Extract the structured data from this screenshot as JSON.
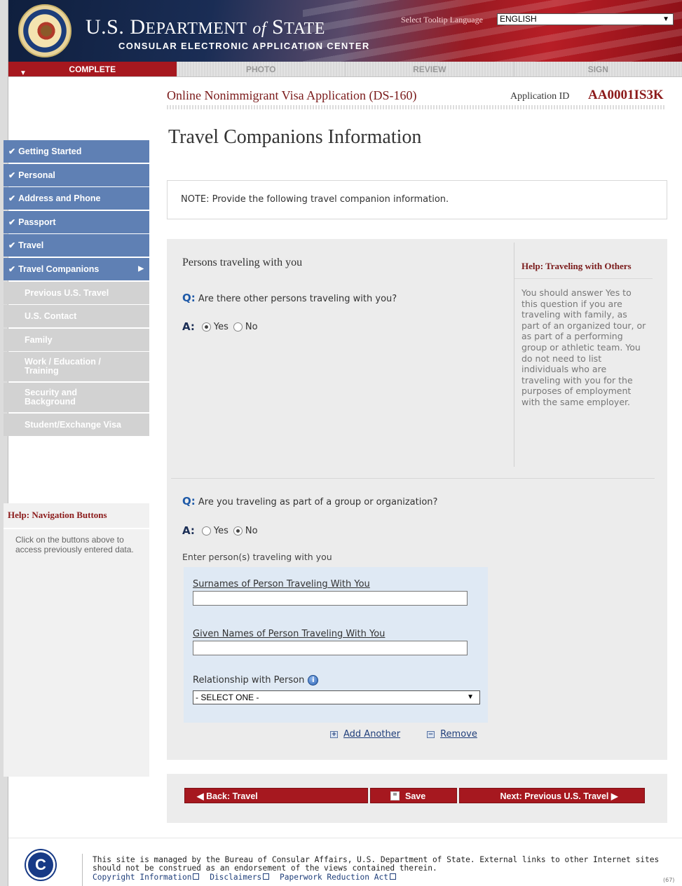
{
  "header": {
    "dept_main": "U.S. D",
    "dept_1": "EPARTMENT",
    "dept_of": "of",
    "dept_2": "S",
    "dept_3": "TATE",
    "subtitle": "CONSULAR ELECTRONIC APPLICATION CENTER",
    "tooltip_language_label": "Select Tooltip Language",
    "tooltip_language_value": "ENGLISH"
  },
  "progress_tabs": [
    {
      "label": "COMPLETE"
    },
    {
      "label": "PHOTO"
    },
    {
      "label": "REVIEW"
    },
    {
      "label": "SIGN"
    }
  ],
  "application": {
    "title": "Online Nonimmigrant Visa Application (DS-160)",
    "id_label": "Application ID",
    "id_value": "AA0001IS3K"
  },
  "page_heading": "Travel Companions Information",
  "sidebar": {
    "items": [
      {
        "label": "Getting Started",
        "state": "done"
      },
      {
        "label": "Personal",
        "state": "done"
      },
      {
        "label": "Address and Phone",
        "state": "done"
      },
      {
        "label": "Passport",
        "state": "done"
      },
      {
        "label": "Travel",
        "state": "done"
      },
      {
        "label": "Travel Companions",
        "state": "current"
      },
      {
        "label": "Previous U.S. Travel",
        "state": "todo"
      },
      {
        "label": "U.S. Contact",
        "state": "todo"
      },
      {
        "label": "Family",
        "state": "todo"
      },
      {
        "label": "Work / Education / Training",
        "state": "todo"
      },
      {
        "label": "Security and Background",
        "state": "todo"
      },
      {
        "label": "Student/Exchange Visa",
        "state": "todo"
      }
    ],
    "help_title_prefix": "Help:",
    "help_title": "Navigation Buttons",
    "help_text": "Click on the buttons above to access previously entered data."
  },
  "note": "NOTE: Provide the following travel companion information.",
  "section": {
    "title": "Persons traveling with you",
    "q_prefix": "Q:",
    "a_prefix": "A:",
    "q1": "Are there other persons traveling with you?",
    "q1_yes": "Yes",
    "q1_no": "No",
    "q2": "Are you traveling as part of a group or organization?",
    "q2_yes": "Yes",
    "q2_no": "No",
    "enter_label": "Enter person(s) traveling with you"
  },
  "help_panel": {
    "prefix": "Help:",
    "title": "Traveling with Others",
    "text": "You should answer Yes to this question if you are traveling with family, as part of an organized tour, or as part of a performing group or athletic team. You do not need to list individuals who are traveling with you for the purposes of employment with the same employer."
  },
  "companion_form": {
    "surname_label": "Surnames of Person Traveling With You",
    "surname_value": "",
    "given_label": "Given Names of Person Traveling With You",
    "given_value": "",
    "relationship_label": "Relationship with Person",
    "relationship_value": "- SELECT ONE -",
    "add_label": "Add Another",
    "remove_label": "Remove"
  },
  "buttons": {
    "back": "Back: Travel",
    "save": "Save",
    "next": "Next: Previous U.S. Travel"
  },
  "footer": {
    "text": "This site is managed by the Bureau of Consular Affairs, U.S. Department of State. External links to other Internet sites should not be construed as an endorsement of the views contained therein.",
    "links": [
      "Copyright Information",
      "Disclaimers",
      "Paperwork Reduction Act"
    ],
    "code": "(67)"
  },
  "colors": {
    "nav_done": "#5f80b4",
    "nav_todo": "#d2d2d2",
    "brand_red": "#a6181f",
    "question_blue": "#1f5aa8"
  }
}
